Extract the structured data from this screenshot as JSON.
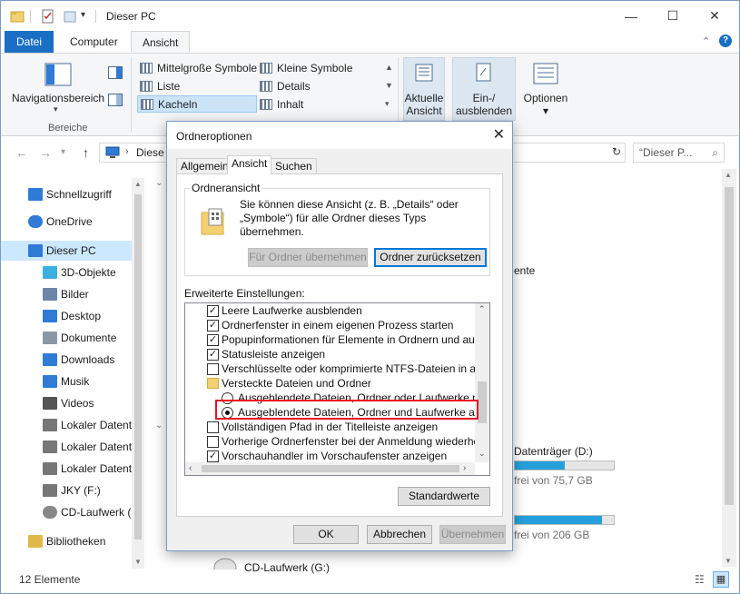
{
  "window": {
    "title": "Dieser PC",
    "min_glyph": "—",
    "max_glyph": "☐",
    "close_glyph": "✕"
  },
  "ribbon": {
    "tabs": [
      "Datei",
      "Computer",
      "Ansicht"
    ],
    "active_tab": "Ansicht",
    "panes_group": {
      "nav_pane_label": "Navigationsbereich",
      "group_label": "Bereiche"
    },
    "layout_items": [
      "Mittelgroße Symbole",
      "Kleine Symbole",
      "Liste",
      "Details",
      "Kacheln",
      "Inhalt"
    ],
    "selected_layout": "Kacheln",
    "current_view": {
      "line1": "Aktuelle",
      "line2": "Ansicht"
    },
    "show_hide": {
      "line1": "Ein-/",
      "line2": "ausblenden"
    },
    "options_label": "Optionen"
  },
  "address": {
    "path": "Diese",
    "search_placeholder": "“Dieser P..."
  },
  "sidebar": {
    "items": [
      {
        "label": "Schnellzugriff",
        "icon": "star-icon"
      },
      {
        "label": "OneDrive",
        "icon": "cloud-icon"
      },
      {
        "label": "Dieser PC",
        "icon": "computer-icon"
      },
      {
        "label": "3D-Objekte",
        "icon": "cube-icon"
      },
      {
        "label": "Bilder",
        "icon": "pictures-icon"
      },
      {
        "label": "Desktop",
        "icon": "desktop-icon"
      },
      {
        "label": "Dokumente",
        "icon": "documents-icon"
      },
      {
        "label": "Downloads",
        "icon": "download-icon"
      },
      {
        "label": "Musik",
        "icon": "music-icon"
      },
      {
        "label": "Videos",
        "icon": "video-icon"
      },
      {
        "label": "Lokaler Datenträ",
        "icon": "drive-icon"
      },
      {
        "label": "Lokaler Datenträ",
        "icon": "drive-icon"
      },
      {
        "label": "Lokaler Datenträ",
        "icon": "drive-icon"
      },
      {
        "label": "JKY (F:)",
        "icon": "drive-icon"
      },
      {
        "label": "CD-Laufwerk (G",
        "icon": "cd-icon"
      },
      {
        "label": "Bibliotheken",
        "icon": "library-icon"
      }
    ]
  },
  "content": {
    "partial_text_1": "ente",
    "drive_d_label": "Datenträger (D:)",
    "drive_d_free": "frei von 75,7 GB",
    "drive_d_used_fraction": 0.5,
    "drive_e_free": "frei von 206 GB",
    "drive_e_used_fraction": 0.88,
    "cd_label": "CD-Laufwerk (G:)"
  },
  "statusbar": {
    "count": "12 Elemente"
  },
  "dialog": {
    "title": "Ordneroptionen",
    "tabs": [
      "Allgemein",
      "Ansicht",
      "Suchen"
    ],
    "active_tab": "Ansicht",
    "folder_view": {
      "legend": "Ordneransicht",
      "description": "Sie können diese Ansicht (z. B. „Details“ oder „Symbole“) für alle Ordner dieses Typs übernehmen.",
      "apply_button": "Für Ordner übernehmen",
      "reset_button": "Ordner zurücksetzen"
    },
    "advanced_label": "Erweiterte Einstellungen:",
    "settings": [
      {
        "type": "checkbox",
        "checked": true,
        "label": "Leere Laufwerke ausblenden"
      },
      {
        "type": "checkbox",
        "checked": true,
        "label": "Ordnerfenster in einem eigenen Prozess starten"
      },
      {
        "type": "checkbox",
        "checked": true,
        "label": "Popupinformationen für Elemente in Ordnern und auf dem D"
      },
      {
        "type": "checkbox",
        "checked": true,
        "label": "Statusleiste anzeigen"
      },
      {
        "type": "checkbox",
        "checked": false,
        "label": "Verschlüsselte oder komprimierte NTFS-Dateien in anderer"
      },
      {
        "type": "folder",
        "label": "Versteckte Dateien und Ordner"
      },
      {
        "type": "radio",
        "checked": false,
        "label": "Ausgeblendete Dateien, Ordner oder Laufwerke nicht a"
      },
      {
        "type": "radio",
        "checked": true,
        "label": "Ausgeblendete Dateien, Ordner und Laufwerke anzeige"
      },
      {
        "type": "checkbox",
        "checked": false,
        "label": "Vollständigen Pfad in der Titelleiste anzeigen"
      },
      {
        "type": "checkbox",
        "checked": false,
        "label": "Vorherige Ordnerfenster bei der Anmeldung wiederherstell"
      },
      {
        "type": "checkbox",
        "checked": true,
        "label": "Vorschauhandler im Vorschaufenster anzeigen"
      }
    ],
    "defaults_button": "Standardwerte",
    "ok_button": "OK",
    "cancel_button": "Abbrechen",
    "apply_button": "Übernehmen"
  },
  "colors": {
    "accent": "#1a6fc4",
    "highlight_box": "#e81123",
    "selection": "#cce8ff"
  }
}
